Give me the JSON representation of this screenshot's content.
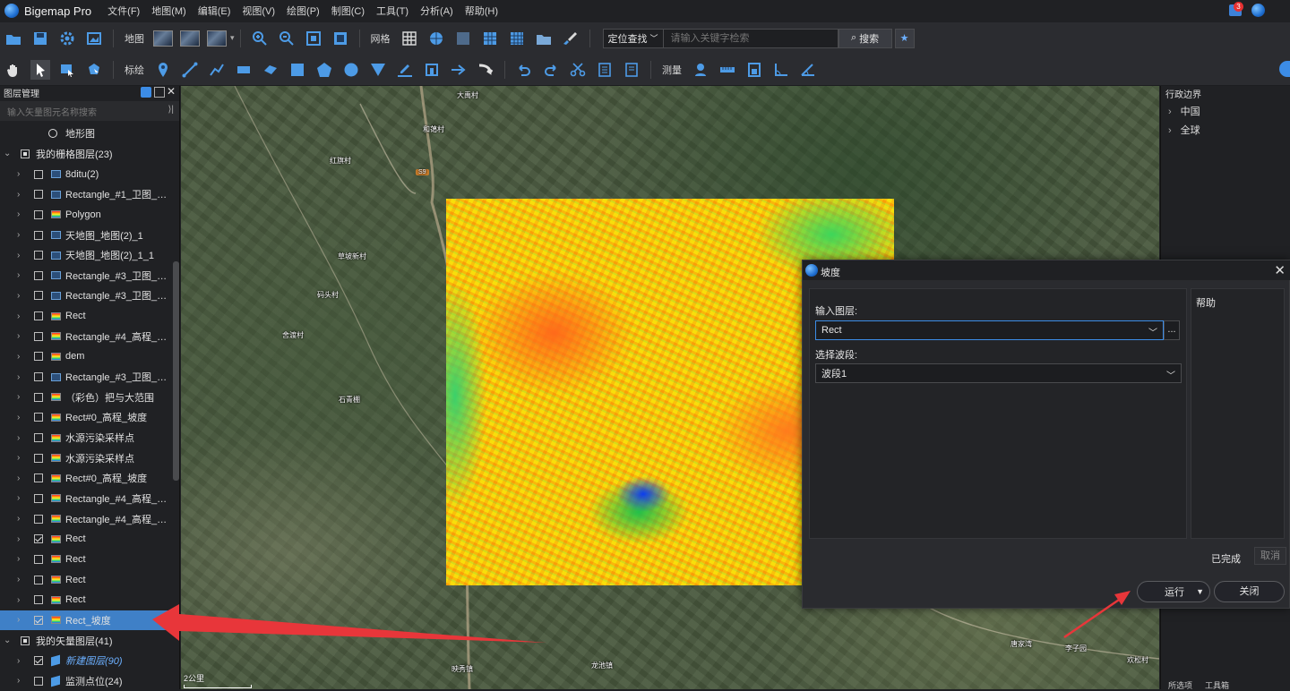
{
  "app": {
    "title": "Bigemap Pro"
  },
  "menu": [
    "文件(F)",
    "地图(M)",
    "编辑(E)",
    "视图(V)",
    "绘图(P)",
    "制图(C)",
    "工具(T)",
    "分析(A)",
    "帮助(H)"
  ],
  "notifications": {
    "count": "3"
  },
  "toolbar1": {
    "map_label": "地图",
    "grid_label": "网格",
    "search_mode": "定位查找",
    "search_placeholder": "请输入关键字检索",
    "search_button": "搜索"
  },
  "toolbar2": {
    "annotate_label": "标绘",
    "measure_label": "测量"
  },
  "layer_panel": {
    "title": "图层管理",
    "search_placeholder": "输入矢量图元名称搜索",
    "terrain_item": "地形图",
    "raster_group": "我的栅格图层(23)",
    "vector_group": "我的矢量图层(41)",
    "layers": [
      {
        "name": "8ditu(2)",
        "checked": false,
        "icon": "blue"
      },
      {
        "name": "Rectangle_#1_卫图_Le...",
        "checked": false,
        "icon": "blue"
      },
      {
        "name": "Polygon",
        "checked": false,
        "icon": "rainbow"
      },
      {
        "name": "天地图_地图(2)_1",
        "checked": false,
        "icon": "blue"
      },
      {
        "name": "天地图_地图(2)_1_1",
        "checked": false,
        "icon": "blue"
      },
      {
        "name": "Rectangle_#3_卫图_Le...",
        "checked": false,
        "icon": "blue"
      },
      {
        "name": "Rectangle_#3_卫图_Le...",
        "checked": false,
        "icon": "blue"
      },
      {
        "name": "Rect",
        "checked": false,
        "icon": "rainbow"
      },
      {
        "name": "Rectangle_#4_高程_Le...",
        "checked": false,
        "icon": "rainbow"
      },
      {
        "name": "dem",
        "checked": false,
        "icon": "rainbow"
      },
      {
        "name": "Rectangle_#3_卫图_Le...",
        "checked": false,
        "icon": "blue"
      },
      {
        "name": "（彩色）把与大范围",
        "checked": false,
        "icon": "rainbow"
      },
      {
        "name": "Rect#0_高程_坡度",
        "checked": false,
        "icon": "rainbow"
      },
      {
        "name": "水源污染采样点",
        "checked": false,
        "icon": "rainbow"
      },
      {
        "name": "水源污染采样点",
        "checked": false,
        "icon": "rainbow"
      },
      {
        "name": "Rect#0_高程_坡度",
        "checked": false,
        "icon": "rainbow"
      },
      {
        "name": "Rectangle_#4_高程_Le...",
        "checked": false,
        "icon": "rainbow"
      },
      {
        "name": "Rectangle_#4_高程_Le...",
        "checked": false,
        "icon": "rainbow"
      },
      {
        "name": "Rect",
        "checked": true,
        "icon": "rainbow"
      },
      {
        "name": "Rect",
        "checked": false,
        "icon": "rainbow"
      },
      {
        "name": "Rect",
        "checked": false,
        "icon": "rainbow"
      },
      {
        "name": "Rect",
        "checked": false,
        "icon": "rainbow"
      },
      {
        "name": "Rect_坡度",
        "checked": true,
        "icon": "rainbow",
        "selected": true
      }
    ],
    "vector_layers": [
      {
        "name": "新建图层(90)",
        "checked": true,
        "italic": true
      },
      {
        "name": "监测点位(24)",
        "checked": false
      }
    ]
  },
  "map": {
    "places": [
      "大禹村",
      "和蔼村",
      "红旗村",
      "草坡新村",
      "码头村",
      "舍渡村",
      "石青棚",
      "唐家湾",
      "李子园",
      "映秀镇",
      "龙池镇",
      "欢松村"
    ],
    "road_shield": "S9",
    "scale": "2公里"
  },
  "right_panel": {
    "title": "行政边界",
    "items": [
      "中国",
      "全球"
    ],
    "tabs": [
      "所选项",
      "工具箱"
    ]
  },
  "dialog": {
    "title": "坡度",
    "input_layer_label": "输入图层:",
    "input_layer_value": "Rect",
    "band_label": "选择波段:",
    "band_value": "波段1",
    "dots": "...",
    "help_title": "帮助",
    "status": "已完成",
    "cancel": "取消",
    "run": "运行",
    "close": "关闭"
  },
  "colors": {
    "accent": "#3f80c7",
    "annotation_arrow": "#e8363a",
    "toolbar_bg": "#2b2c30",
    "panel_bg": "#202124"
  }
}
